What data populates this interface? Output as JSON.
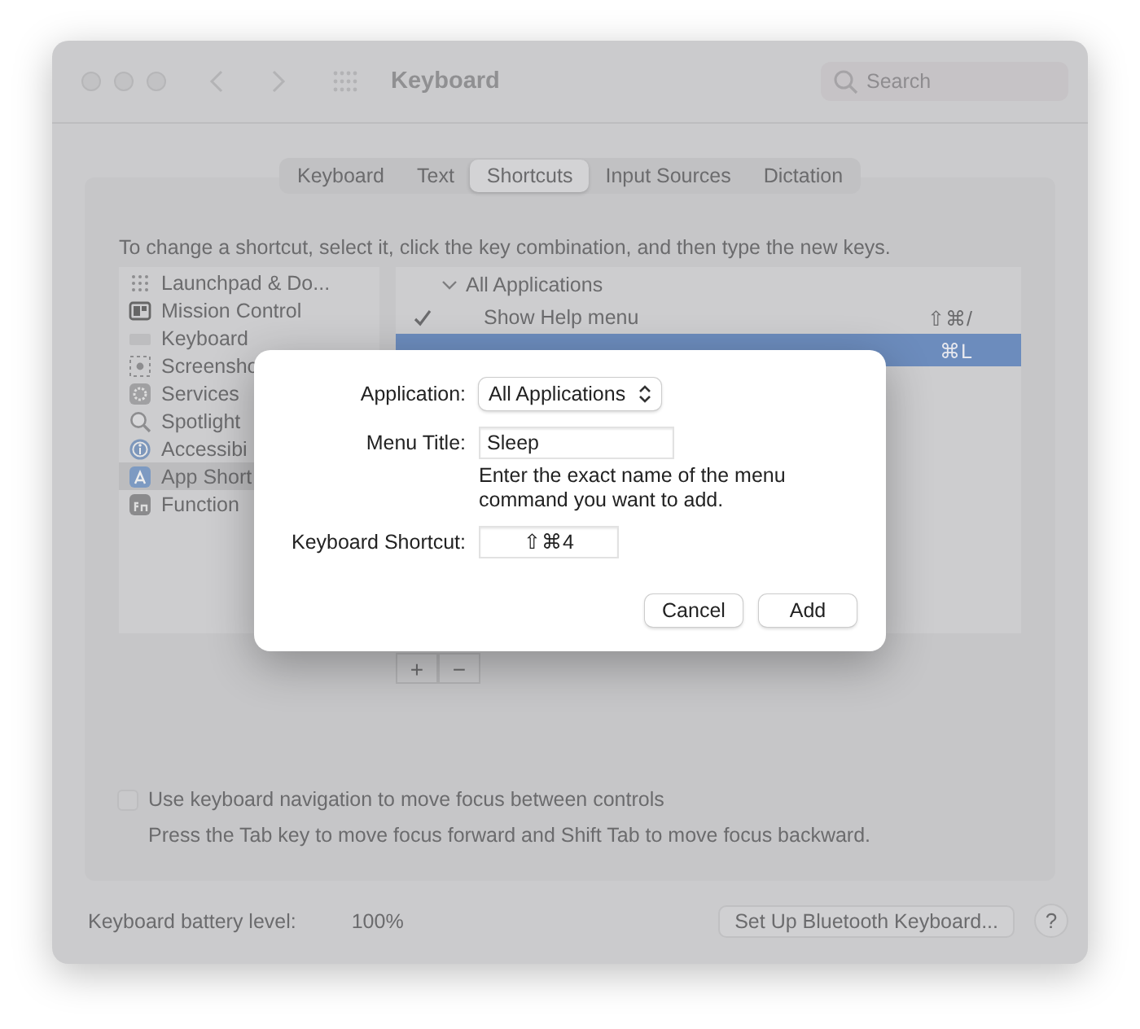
{
  "window": {
    "title": "Keyboard",
    "search": {
      "placeholder": "Search"
    }
  },
  "tabs": [
    {
      "label": "Keyboard",
      "selected": false
    },
    {
      "label": "Text",
      "selected": false
    },
    {
      "label": "Shortcuts",
      "selected": true
    },
    {
      "label": "Input Sources",
      "selected": false
    },
    {
      "label": "Dictation",
      "selected": false
    }
  ],
  "instruction": "To change a shortcut, select it, click the key combination, and then type the new keys.",
  "categories": [
    {
      "label": "Launchpad & Do...",
      "kind": "grid",
      "selected": false
    },
    {
      "label": "Mission Control",
      "kind": "windows",
      "selected": false
    },
    {
      "label": "Keyboard",
      "kind": "keyboard",
      "selected": false
    },
    {
      "label": "Screensho",
      "kind": "screenshot",
      "selected": false
    },
    {
      "label": "Services",
      "kind": "gear",
      "selected": false
    },
    {
      "label": "Spotlight",
      "kind": "magnifier",
      "selected": false
    },
    {
      "label": "Accessibi",
      "kind": "accessibility",
      "selected": false
    },
    {
      "label": "App Short",
      "kind": "app",
      "selected": true
    },
    {
      "label": "Function",
      "kind": "fn",
      "selected": false
    }
  ],
  "shortcuts": [
    {
      "label": "All Applications",
      "expanded": true,
      "children": [
        {
          "label": "Show Help menu",
          "checked": true,
          "keys": "⇧⌘/",
          "selected": false
        },
        {
          "keys": "⌘L",
          "selected": true
        }
      ]
    }
  ],
  "list_buttons": [
    "+",
    "−"
  ],
  "keyboard_navigation": {
    "label": "Use keyboard navigation to move focus between controls",
    "checked": false,
    "hint": "Press the Tab key to move focus forward and Shift Tab to move focus backward."
  },
  "battery": {
    "label": "Keyboard battery level:",
    "value": "100%"
  },
  "bluetooth_button": "Set Up Bluetooth Keyboard...",
  "help_button": "?",
  "dialog": {
    "application": {
      "label": "Application:",
      "value": "All Applications"
    },
    "menu_title": {
      "label": "Menu Title:",
      "value": "Sleep",
      "hint": "Enter the exact name of the menu command you want to add."
    },
    "shortcut": {
      "label": "Keyboard Shortcut:",
      "value": "⇧⌘4"
    },
    "buttons": [
      "Cancel",
      "Add"
    ]
  }
}
